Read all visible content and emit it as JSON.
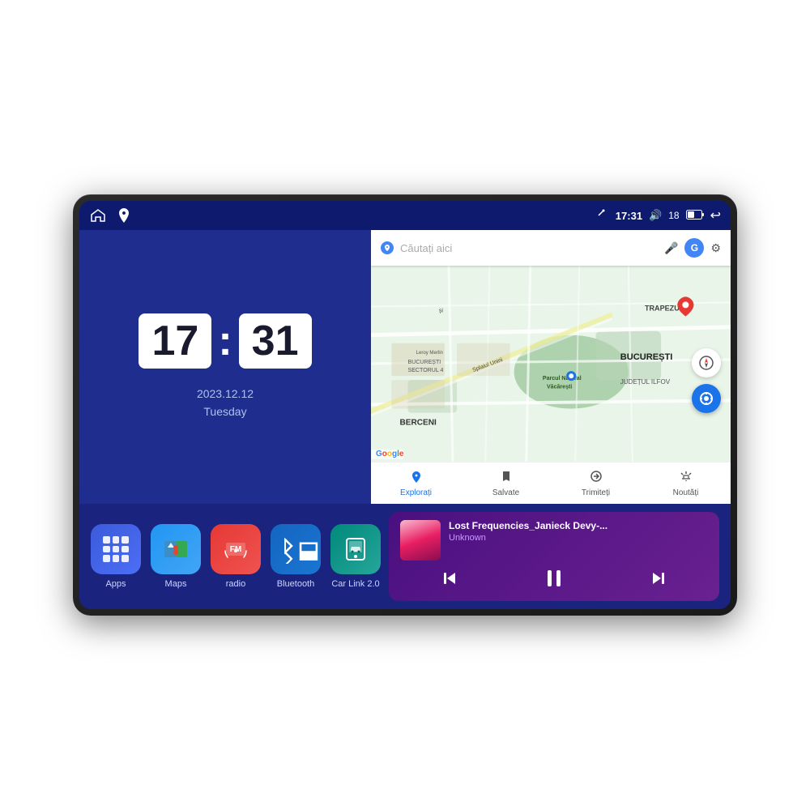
{
  "device": {
    "statusBar": {
      "signal_icon": "▽",
      "time": "17:31",
      "volume_icon": "🔊",
      "battery_level": "18",
      "battery_icon": "▭",
      "back_icon": "↩"
    },
    "navBar": {
      "home_icon": "⌂",
      "maps_icon": "📍"
    },
    "clock": {
      "hours": "17",
      "minutes": "31",
      "date": "2023.12.12",
      "weekday": "Tuesday"
    },
    "map": {
      "search_placeholder": "Căutați aici",
      "nav_items": [
        {
          "label": "Explorați",
          "icon": "📍",
          "active": true
        },
        {
          "label": "Salvate",
          "icon": "🔖",
          "active": false
        },
        {
          "label": "Trimiteți",
          "icon": "↗",
          "active": false
        },
        {
          "label": "Noutăți",
          "icon": "🔔",
          "active": false
        }
      ],
      "map_labels": [
        "TRAPEZULUI",
        "BUCUREȘTI",
        "JUDEȚUL ILFOV",
        "BERCENI",
        "Leroy Merlin",
        "Parcul Natural Văcărești",
        "BUCUREȘTI SECTORUL 4",
        "Splaiul Unirii"
      ]
    },
    "apps": [
      {
        "id": "apps",
        "label": "Apps",
        "icon_type": "grid",
        "color": "icon-apps"
      },
      {
        "id": "maps",
        "label": "Maps",
        "icon_type": "map",
        "color": "icon-maps"
      },
      {
        "id": "radio",
        "label": "radio",
        "icon_type": "radio",
        "color": "icon-radio"
      },
      {
        "id": "bluetooth",
        "label": "Bluetooth",
        "icon_type": "bluetooth",
        "color": "icon-bluetooth"
      },
      {
        "id": "carlink",
        "label": "Car Link 2.0",
        "icon_type": "phone",
        "color": "icon-carlink"
      }
    ],
    "music": {
      "title": "Lost Frequencies_Janieck Devy-...",
      "artist": "Unknown",
      "prev_icon": "⏮",
      "play_icon": "⏸",
      "next_icon": "⏭"
    }
  }
}
